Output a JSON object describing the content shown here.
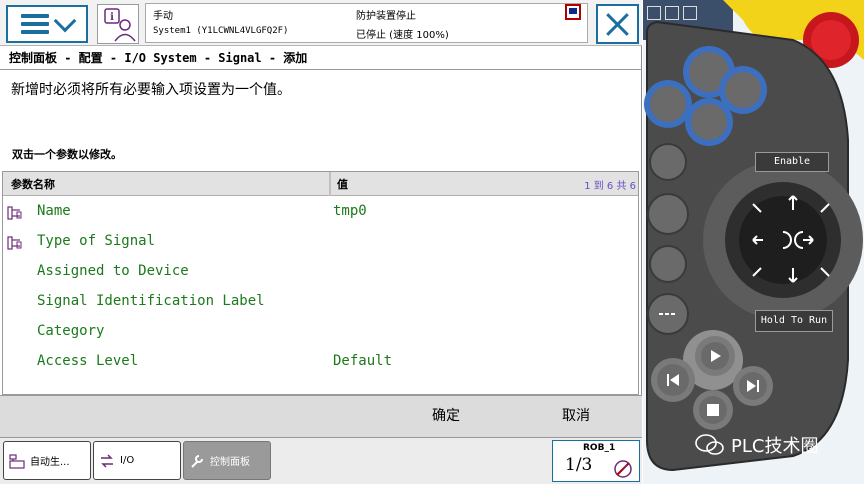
{
  "header": {
    "mode_label": "手动",
    "system_label": "System1 (Y1LCWNL4VLGFQ2F)",
    "guard_status": "防护装置停止",
    "run_status": "已停止 (速度 100%)"
  },
  "breadcrumb": "控制面板 - 配置 - I/O System - Signal - 添加",
  "instructions": {
    "line1": "新增时必须将所有必要输入项设置为一个值。",
    "line2": "双击一个参数以修改。"
  },
  "table": {
    "col_name": "参数名称",
    "col_value": "值",
    "count": "1 到 6 共 6",
    "rows": [
      {
        "name": "Name",
        "value": "tmp0",
        "has_icon": true
      },
      {
        "name": "Type of Signal",
        "value": "",
        "has_icon": true
      },
      {
        "name": "Assigned to Device",
        "value": "",
        "has_icon": false
      },
      {
        "name": "Signal Identification Label",
        "value": "",
        "has_icon": false
      },
      {
        "name": "Category",
        "value": "",
        "has_icon": false
      },
      {
        "name": "Access Level",
        "value": "Default",
        "has_icon": false
      }
    ]
  },
  "buttons": {
    "ok": "确定",
    "cancel": "取消"
  },
  "taskbar": {
    "items": [
      {
        "label": "自动生...",
        "icon": "auto-production-icon"
      },
      {
        "label": "I/O",
        "icon": "io-icon"
      },
      {
        "label": "控制面板",
        "icon": "wrench-icon"
      }
    ],
    "robot_label": "ROB_1",
    "task_fraction": "1/3"
  },
  "pendant": {
    "enable_label": "Enable",
    "hold_label": "Hold To Run"
  },
  "watermark": "PLC技术圈",
  "colors": {
    "accent": "#1a6fa0",
    "param_green": "#1b7a1b",
    "count_purple": "#6a4cc2"
  }
}
